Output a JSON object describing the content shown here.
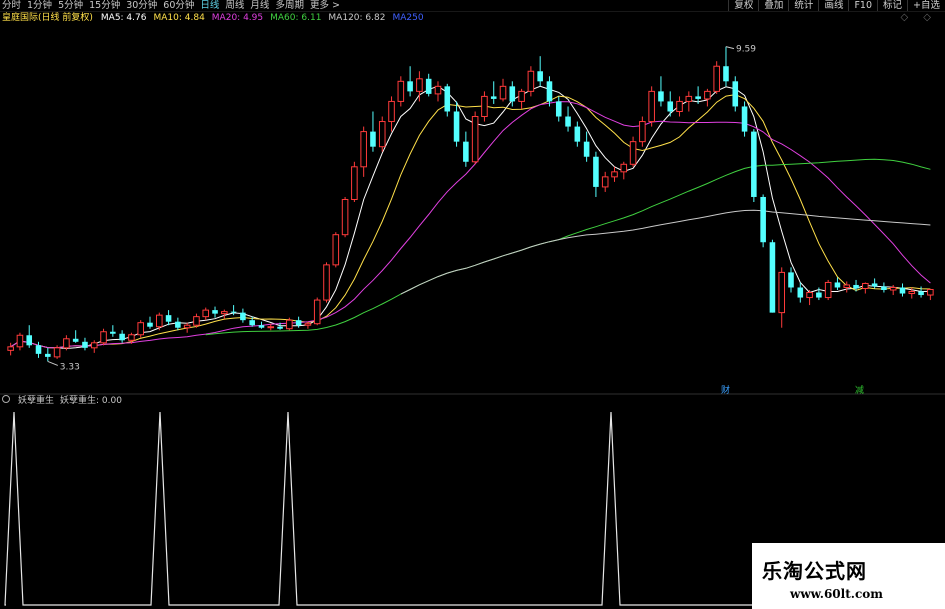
{
  "toolbar": {
    "tabs": [
      "分时",
      "1分钟",
      "5分钟",
      "15分钟",
      "30分钟",
      "60分钟",
      "日线",
      "周线",
      "月线",
      "多周期",
      "更多 >"
    ],
    "active_tab": "日线",
    "tools": [
      "复权",
      "叠加",
      "统计",
      "画线",
      "F10",
      "标记",
      "+自选"
    ]
  },
  "main_legend": {
    "title": "皇庭国际(日线 前复权)",
    "ma": [
      {
        "label": "MA5: 4.76",
        "color": "#ffffff"
      },
      {
        "label": "MA10: 4.84",
        "color": "#ffe04a"
      },
      {
        "label": "MA20: 4.95",
        "color": "#e040e0"
      },
      {
        "label": "MA60: 6.11",
        "color": "#40d040"
      },
      {
        "label": "MA120: 6.82",
        "color": "#c8c8c8"
      },
      {
        "label": "MA250",
        "color": "#4060ff"
      }
    ]
  },
  "annotations": {
    "high_label": "9.59",
    "low_label": "3.33",
    "badge_cai": "财",
    "badge_jian": "减"
  },
  "sub_legend": {
    "name": "妖孽重生",
    "value_label": "妖孽重生: 0.00"
  },
  "watermark": {
    "title": "乐淘公式网",
    "url": "www.60lt.com"
  },
  "colors": {
    "up": "#ff3b3b",
    "down": "#54ffff",
    "ma5": "#ffffff",
    "ma10": "#ffe04a",
    "ma20": "#e040e0",
    "ma60": "#40d040",
    "ma120": "#c8c8c8",
    "active_tab": "#5fd2e6"
  },
  "chart_data": {
    "type": "candlestick",
    "price_range": [
      3.0,
      10.0
    ],
    "candles": [
      [
        3.55,
        3.7,
        3.45,
        3.62
      ],
      [
        3.62,
        3.9,
        3.55,
        3.85
      ],
      [
        3.85,
        4.05,
        3.6,
        3.65
      ],
      [
        3.65,
        3.72,
        3.4,
        3.48
      ],
      [
        3.48,
        3.6,
        3.33,
        3.42
      ],
      [
        3.42,
        3.65,
        3.38,
        3.6
      ],
      [
        3.6,
        3.85,
        3.55,
        3.78
      ],
      [
        3.78,
        3.95,
        3.7,
        3.72
      ],
      [
        3.72,
        3.8,
        3.55,
        3.6
      ],
      [
        3.6,
        3.75,
        3.5,
        3.7
      ],
      [
        3.7,
        3.98,
        3.65,
        3.92
      ],
      [
        3.92,
        4.05,
        3.82,
        3.88
      ],
      [
        3.88,
        3.95,
        3.7,
        3.75
      ],
      [
        3.75,
        3.9,
        3.68,
        3.86
      ],
      [
        3.86,
        4.15,
        3.8,
        4.1
      ],
      [
        4.1,
        4.22,
        3.98,
        4.02
      ],
      [
        4.02,
        4.3,
        3.95,
        4.25
      ],
      [
        4.25,
        4.35,
        4.05,
        4.12
      ],
      [
        4.12,
        4.2,
        3.95,
        4.0
      ],
      [
        4.0,
        4.1,
        3.9,
        4.05
      ],
      [
        4.05,
        4.28,
        4.0,
        4.22
      ],
      [
        4.22,
        4.4,
        4.15,
        4.35
      ],
      [
        4.35,
        4.42,
        4.2,
        4.28
      ],
      [
        4.28,
        4.36,
        4.18,
        4.32
      ],
      [
        4.32,
        4.45,
        4.25,
        4.3
      ],
      [
        4.3,
        4.38,
        4.1,
        4.15
      ],
      [
        4.15,
        4.22,
        4.02,
        4.05
      ],
      [
        4.05,
        4.12,
        3.98,
        4.0
      ],
      [
        4.0,
        4.08,
        3.95,
        4.02
      ],
      [
        4.02,
        4.1,
        3.96,
        3.98
      ],
      [
        3.98,
        4.2,
        3.95,
        4.15
      ],
      [
        4.15,
        4.22,
        4.0,
        4.05
      ],
      [
        4.05,
        4.12,
        3.98,
        4.08
      ],
      [
        4.08,
        4.6,
        4.05,
        4.55
      ],
      [
        4.55,
        5.3,
        4.5,
        5.25
      ],
      [
        5.25,
        5.9,
        5.2,
        5.85
      ],
      [
        5.85,
        6.6,
        5.8,
        6.55
      ],
      [
        6.55,
        7.3,
        6.5,
        7.2
      ],
      [
        7.2,
        8.0,
        7.0,
        7.9
      ],
      [
        7.9,
        8.3,
        7.5,
        7.6
      ],
      [
        7.6,
        8.2,
        7.5,
        8.1
      ],
      [
        8.1,
        8.6,
        7.9,
        8.5
      ],
      [
        8.5,
        9.0,
        8.4,
        8.9
      ],
      [
        8.9,
        9.2,
        8.6,
        8.7
      ],
      [
        8.7,
        9.1,
        8.5,
        8.95
      ],
      [
        8.95,
        9.05,
        8.6,
        8.65
      ],
      [
        8.65,
        8.9,
        8.5,
        8.8
      ],
      [
        8.8,
        8.85,
        8.2,
        8.3
      ],
      [
        8.3,
        8.5,
        7.6,
        7.7
      ],
      [
        7.7,
        7.9,
        7.2,
        7.3
      ],
      [
        7.3,
        8.3,
        7.25,
        8.2
      ],
      [
        8.2,
        8.7,
        8.1,
        8.6
      ],
      [
        8.6,
        8.9,
        8.45,
        8.55
      ],
      [
        8.55,
        8.95,
        8.5,
        8.8
      ],
      [
        8.8,
        8.9,
        8.4,
        8.5
      ],
      [
        8.5,
        8.75,
        8.35,
        8.7
      ],
      [
        8.7,
        9.2,
        8.6,
        9.1
      ],
      [
        9.1,
        9.4,
        8.8,
        8.9
      ],
      [
        8.9,
        9.0,
        8.4,
        8.5
      ],
      [
        8.5,
        8.6,
        8.1,
        8.2
      ],
      [
        8.2,
        8.4,
        7.9,
        8.0
      ],
      [
        8.0,
        8.1,
        7.6,
        7.7
      ],
      [
        7.7,
        7.9,
        7.3,
        7.4
      ],
      [
        7.4,
        7.5,
        6.6,
        6.8
      ],
      [
        6.8,
        7.1,
        6.7,
        7.0
      ],
      [
        7.0,
        7.2,
        6.9,
        7.1
      ],
      [
        7.1,
        7.3,
        6.95,
        7.25
      ],
      [
        7.25,
        7.8,
        7.2,
        7.7
      ],
      [
        7.7,
        8.2,
        7.6,
        8.1
      ],
      [
        8.1,
        8.8,
        8.0,
        8.7
      ],
      [
        8.7,
        9.0,
        8.4,
        8.5
      ],
      [
        8.5,
        8.7,
        8.2,
        8.3
      ],
      [
        8.3,
        8.6,
        8.2,
        8.5
      ],
      [
        8.5,
        8.7,
        8.3,
        8.6
      ],
      [
        8.6,
        8.8,
        8.45,
        8.55
      ],
      [
        8.55,
        8.75,
        8.4,
        8.7
      ],
      [
        8.7,
        9.3,
        8.65,
        9.2
      ],
      [
        9.2,
        9.59,
        8.8,
        8.9
      ],
      [
        8.9,
        9.0,
        8.3,
        8.4
      ],
      [
        8.4,
        8.5,
        7.8,
        7.9
      ],
      [
        7.9,
        7.95,
        6.5,
        6.6
      ],
      [
        6.6,
        6.65,
        5.6,
        5.7
      ],
      [
        5.7,
        5.75,
        4.3,
        4.3
      ],
      [
        4.3,
        5.2,
        4.0,
        5.1
      ],
      [
        5.1,
        5.2,
        4.7,
        4.8
      ],
      [
        4.8,
        4.9,
        4.5,
        4.6
      ],
      [
        4.6,
        4.75,
        4.45,
        4.7
      ],
      [
        4.7,
        4.8,
        4.55,
        4.6
      ],
      [
        4.6,
        4.95,
        4.55,
        4.9
      ],
      [
        4.9,
        5.0,
        4.75,
        4.8
      ],
      [
        4.8,
        4.92,
        4.7,
        4.85
      ],
      [
        4.85,
        4.95,
        4.72,
        4.78
      ],
      [
        4.78,
        4.9,
        4.68,
        4.88
      ],
      [
        4.88,
        4.98,
        4.78,
        4.82
      ],
      [
        4.82,
        4.9,
        4.7,
        4.75
      ],
      [
        4.75,
        4.85,
        4.65,
        4.8
      ],
      [
        4.8,
        4.88,
        4.62,
        4.68
      ],
      [
        4.68,
        4.8,
        4.58,
        4.72
      ],
      [
        4.72,
        4.82,
        4.6,
        4.65
      ],
      [
        4.65,
        4.75,
        4.55,
        4.76
      ]
    ],
    "ma_summary": {
      "MA5": 4.76,
      "MA10": 4.84,
      "MA20": 4.95,
      "MA60": 6.11,
      "MA120": 6.82
    },
    "indicator": {
      "name": "妖孽重生",
      "spike_bars": [
        2,
        33,
        60,
        131
      ],
      "value": 0.0
    }
  }
}
